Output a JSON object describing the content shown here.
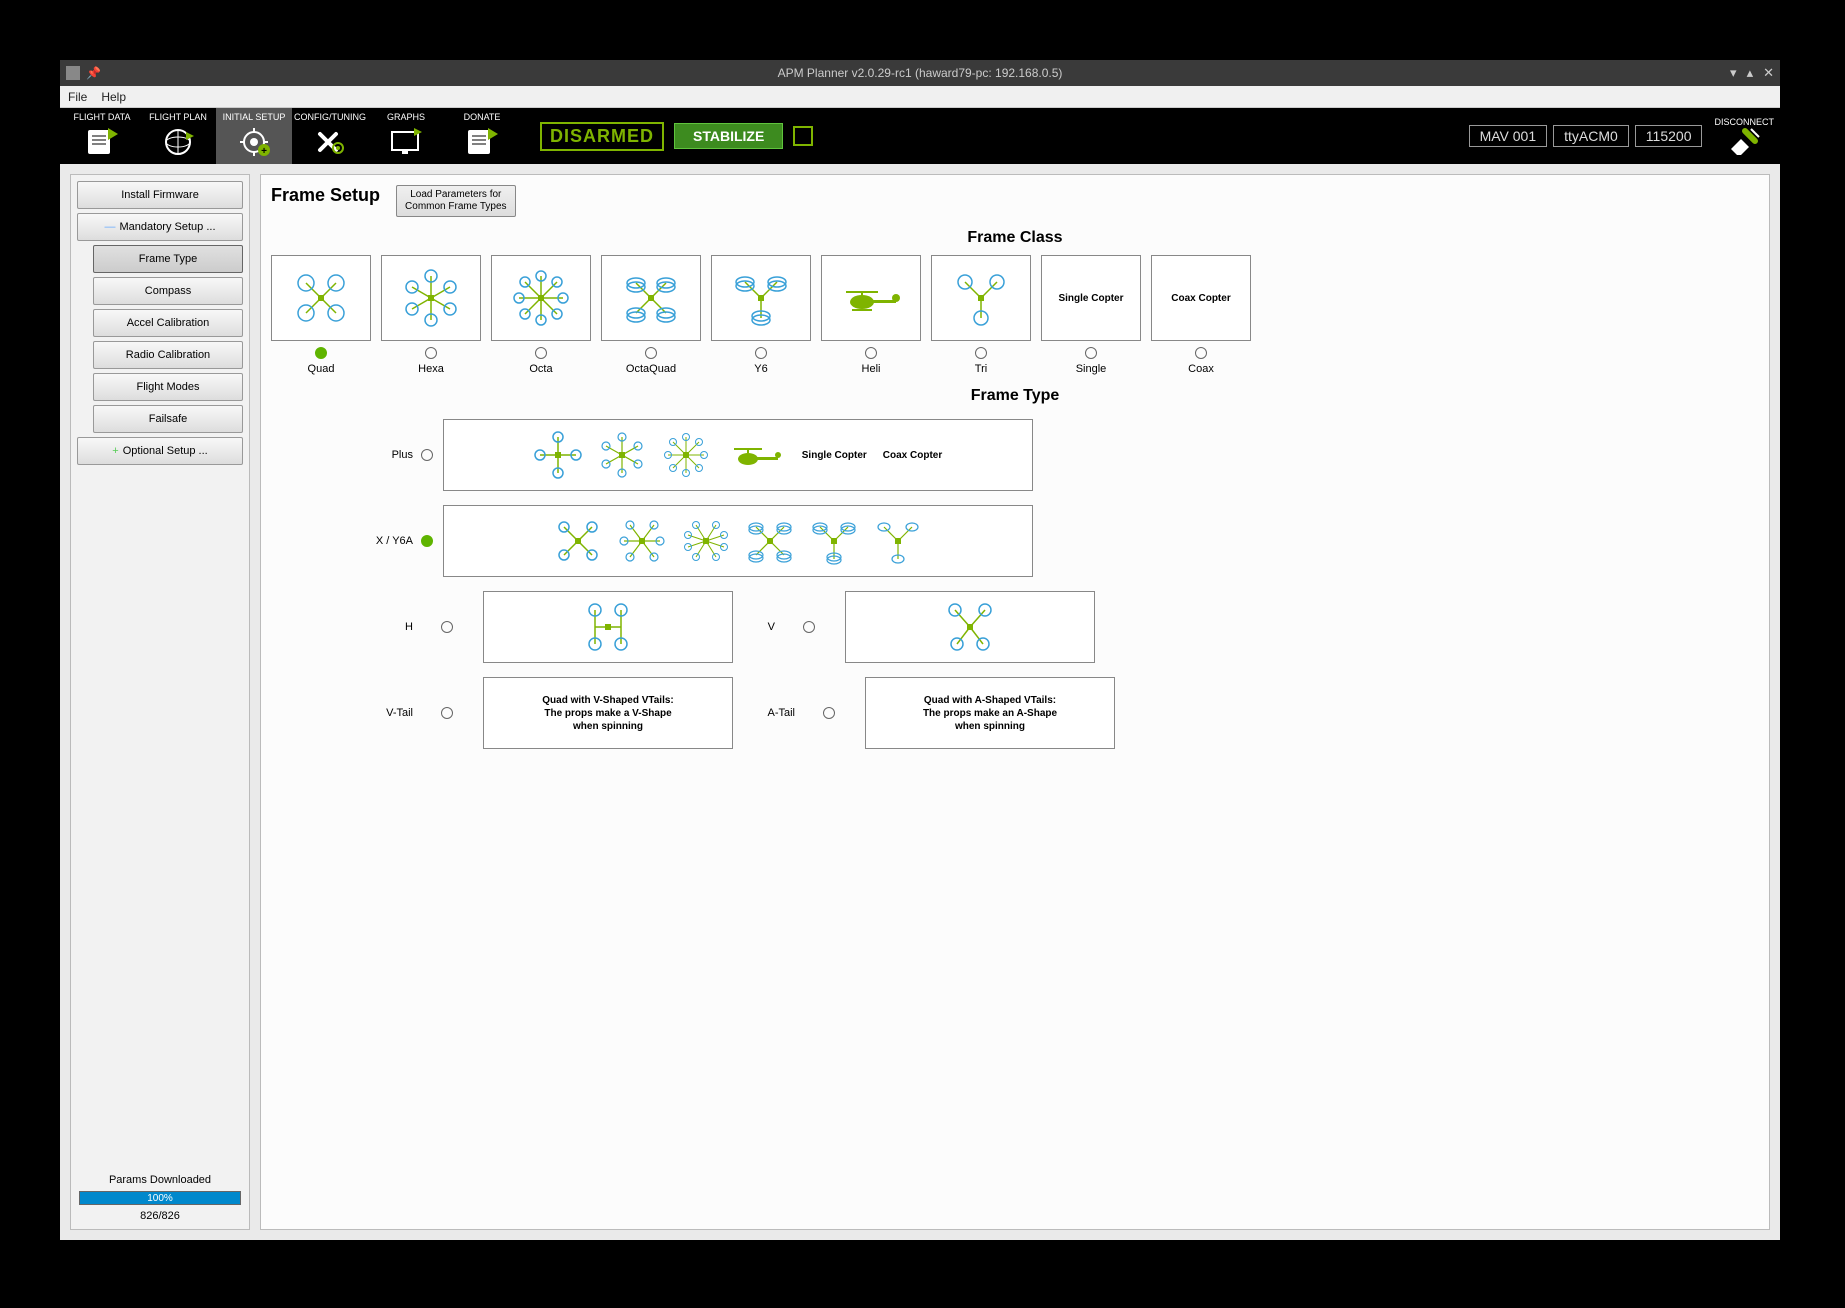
{
  "titlebar": {
    "title": "APM Planner v2.0.29-rc1 (haward79-pc: 192.168.0.5)"
  },
  "menubar": {
    "file": "File",
    "help": "Help"
  },
  "tabs": {
    "flight_data": "FLIGHT DATA",
    "flight_plan": "FLIGHT PLAN",
    "initial_setup": "INITIAL SETUP",
    "config_tuning": "CONFIG/TUNING",
    "graphs": "GRAPHS",
    "donate": "DONATE",
    "disconnect": "DISCONNECT"
  },
  "status": {
    "disarmed": "DISARMED",
    "mode": "STABILIZE",
    "mav": "MAV 001",
    "port": "ttyACM0",
    "baud": "115200"
  },
  "sidebar": {
    "install": "Install Firmware",
    "mandatory": "Mandatory Setup ...",
    "frame_type": "Frame Type",
    "compass": "Compass",
    "accel": "Accel Calibration",
    "radio": "Radio Calibration",
    "flight_modes": "Flight Modes",
    "failsafe": "Failsafe",
    "optional": "Optional Setup ...",
    "params_dl": "Params Downloaded",
    "progress": "100%",
    "params_count": "826/826"
  },
  "main": {
    "title": "Frame Setup",
    "load_params": "Load Parameters for\nCommon Frame Types",
    "frame_class_title": "Frame Class",
    "frame_type_title": "Frame Type",
    "fc": {
      "quad": "Quad",
      "hexa": "Hexa",
      "octa": "Octa",
      "octaquad": "OctaQuad",
      "y6": "Y6",
      "heli": "Heli",
      "tri": "Tri",
      "single": "Single",
      "coax": "Coax",
      "single_label": "Single Copter",
      "coax_label": "Coax Copter"
    },
    "ft": {
      "plus": "Plus",
      "x_y6a": "X / Y6A",
      "h": "H",
      "v": "V",
      "vtail": "V-Tail",
      "atail": "A-Tail",
      "single_copter": "Single Copter",
      "coax_copter": "Coax Copter",
      "vtail_text": "Quad with V-Shaped VTails:\nThe props make a V-Shape\nwhen spinning",
      "atail_text": "Quad with A-Shaped VTails:\nThe props make an A-Shape\nwhen spinning"
    }
  }
}
